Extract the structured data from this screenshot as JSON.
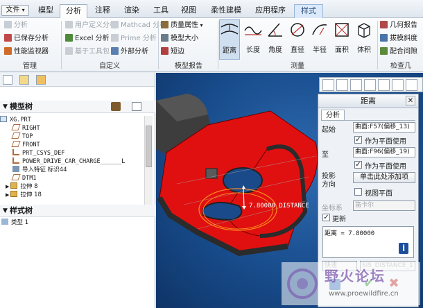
{
  "menu": {
    "file": "文件",
    "file_caret": "▾",
    "tabs": [
      "模型",
      "分析",
      "注释",
      "渲染",
      "工具",
      "视图",
      "柔性建模",
      "应用程序"
    ],
    "active_tab": "分析",
    "sample_tab": "样式"
  },
  "ribbon": {
    "manage": {
      "items": [
        "分析",
        "已保存分析",
        "性能监视器"
      ],
      "label": "管理"
    },
    "custom": {
      "items": [
        "用户定义分析",
        "Excel 分析",
        "基于工具包",
        "Mathcad 分析",
        "Prime 分析",
        "外部分析"
      ],
      "label": "自定义"
    },
    "model_report": {
      "items": [
        "质量属性",
        "模型大小",
        "短边"
      ],
      "label": "模型报告"
    },
    "measure": {
      "buttons": [
        "距离",
        "长度",
        "角度",
        "直径",
        "半径",
        "面积",
        "体积"
      ],
      "selected": "距离",
      "label": "测量"
    },
    "inspect": {
      "items": [
        "几何报告",
        "拔模斜度",
        "配合间隙"
      ],
      "label": "检查几"
    }
  },
  "left_panel": {
    "model_tree_title": "模型树",
    "tree_rows": [
      "XG.PRT",
      "RIGHT",
      "TOP",
      "FRONT",
      "PRT_CSYS_DEF",
      "POWER_DRIVE_CAR_CHARGE______L",
      "导入特征 标识44",
      "DTM1",
      "拉伸 8",
      "拉伸 18"
    ],
    "style_tree_title": "样式树",
    "style_rows": [
      "类型 1"
    ]
  },
  "viewport": {
    "dimension_label": "7.80000  DISTANCE"
  },
  "dialog": {
    "title": "距离",
    "tab": "分析",
    "start_label": "起始",
    "start_value": "曲面:F57(偏移_13)",
    "use_plane_label": "作为平面使用",
    "to_label": "至",
    "to_value": "曲面:F96(偏移_19)",
    "projection_label": "投影方向",
    "projection_button": "单击此处添加项",
    "view_plane_label": "视图平面",
    "csys_label": "坐标系",
    "csys_value": "笛卡尔",
    "update_label": "更新",
    "result": "距离 = 7.80000",
    "mode_value": "快速",
    "name_value": "SIS_DISTANCE_1",
    "info_glyph": "i",
    "ok_glyph": "✔",
    "cancel_glyph": "✖",
    "check_glyph": "✓",
    "close_glyph": "✕"
  },
  "watermark": {
    "title": "野火论坛",
    "url": "www.proewildfire.cn"
  },
  "colors": {
    "viewport_bg": "#184c8c",
    "part_red": "#e01010",
    "part_dark": "#3a3a3a",
    "selection_orange": "#ff8a1e",
    "accent_blue": "#1b4f9c"
  }
}
